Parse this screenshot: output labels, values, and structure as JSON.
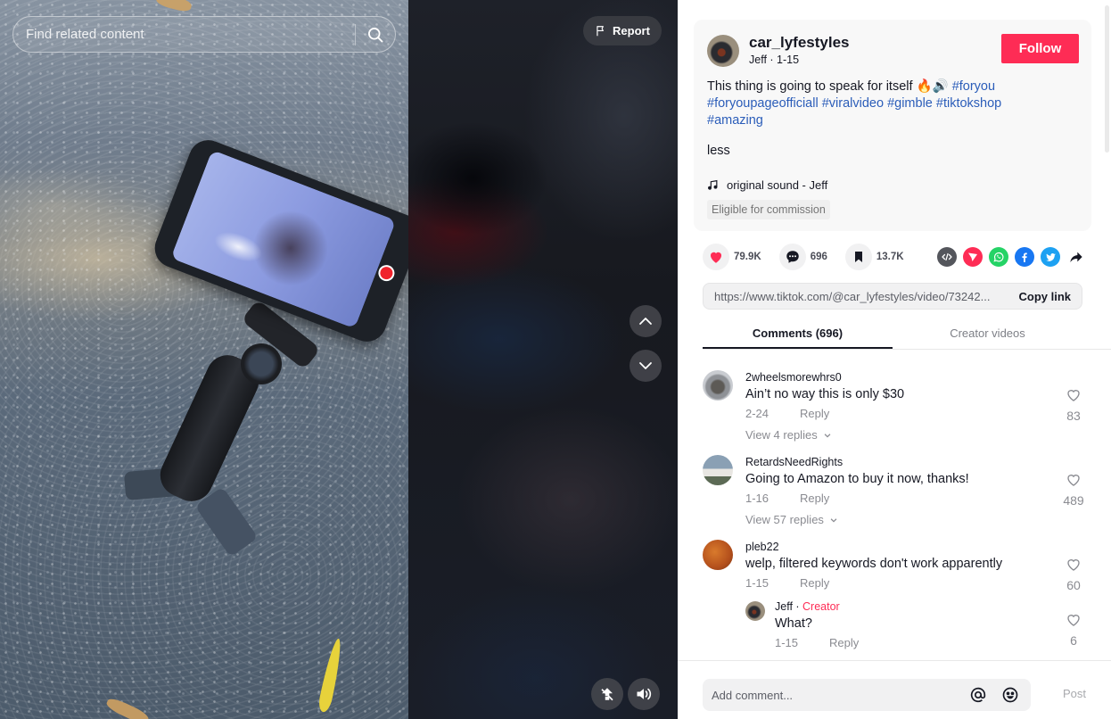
{
  "video": {
    "search": {
      "placeholder": "Find related content"
    },
    "report_label": "Report",
    "icons": {
      "search": "search-icon",
      "report": "flag-icon",
      "nav_up": "chevron-up-icon",
      "nav_down": "chevron-down-icon",
      "floating_player": "floating-player-icon",
      "volume": "volume-icon"
    }
  },
  "post": {
    "username": "car_lyfestyles",
    "nickname": "Jeff",
    "date": "1-15",
    "meta_separator": " · ",
    "follow_label": "Follow",
    "caption_text": "This thing is going to speak for itself ",
    "caption_emoji": "🔥🔊",
    "hashtags": [
      "#foryou",
      "#foryoupageofficiall",
      "#viralvideo",
      "#gimble",
      "#tiktokshop",
      "#amazing"
    ],
    "less_label": "less",
    "sound": "original sound - Jeff",
    "commission_badge": "Eligible for commission"
  },
  "actions": {
    "likes": "79.9K",
    "comments": "696",
    "saves": "13.7K",
    "share_targets": [
      "embed",
      "send-to-friends",
      "whatsapp",
      "facebook",
      "twitter",
      "more-share"
    ]
  },
  "link": {
    "url": "https://www.tiktok.com/@car_lyfestyles/video/73242...",
    "copy_label": "Copy link"
  },
  "tabs": [
    {
      "label": "Comments (696)",
      "active": true
    },
    {
      "label": "Creator videos",
      "active": false
    }
  ],
  "comments": [
    {
      "user": "2wheelsmorewhrs0",
      "text": "Ain’t no way this is only $30",
      "date": "2-24",
      "reply_label": "Reply",
      "likes": "83",
      "view_replies": "View 4 replies"
    },
    {
      "user": "RetardsNeedRights",
      "text": "Going to Amazon to buy it now, thanks!",
      "date": "1-16",
      "reply_label": "Reply",
      "likes": "489",
      "view_replies": "View 57 replies"
    },
    {
      "user": "pleb22",
      "text": "welp, filtered keywords don't work apparently",
      "date": "1-15",
      "reply_label": "Reply",
      "likes": "60",
      "reply": {
        "user": "Jeff",
        "separator": " · ",
        "badge": "Creator",
        "text": "What?",
        "date": "1-15",
        "reply_label": "Reply",
        "likes": "6"
      }
    }
  ],
  "composer": {
    "placeholder": "Add comment...",
    "post_label": "Post"
  },
  "colors": {
    "accent": "#fe2c55",
    "hashtag": "#2b5db9",
    "like_heart": "#fe2c55",
    "whatsapp": "#25d366",
    "facebook": "#1877f2",
    "twitter": "#1da1f2",
    "embed": "#54565c"
  }
}
